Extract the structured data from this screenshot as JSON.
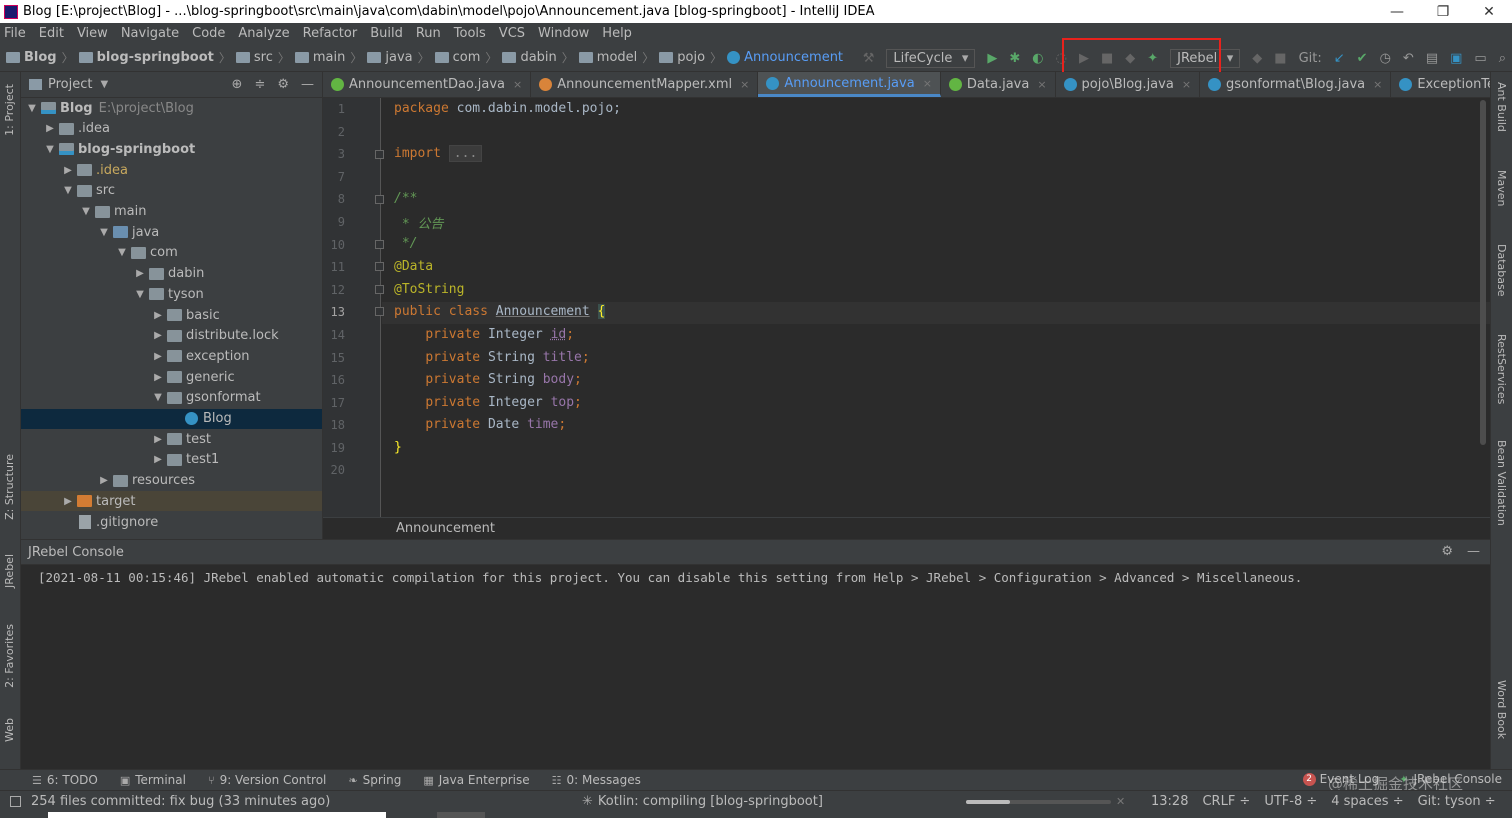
{
  "window": {
    "title": "Blog [E:\\project\\Blog] - ...\\blog-springboot\\src\\main\\java\\com\\dabin\\model\\pojo\\Announcement.java [blog-springboot] - IntelliJ IDEA",
    "controls": [
      "—",
      "❐",
      "✕"
    ]
  },
  "menu": [
    "File",
    "Edit",
    "View",
    "Navigate",
    "Code",
    "Analyze",
    "Refactor",
    "Build",
    "Run",
    "Tools",
    "VCS",
    "Window",
    "Help"
  ],
  "breadcrumbs": [
    "Blog",
    "blog-springboot",
    "src",
    "main",
    "java",
    "com",
    "dabin",
    "model",
    "pojo",
    "Announcement"
  ],
  "toolbar": {
    "lifecycle": "LifeCycle",
    "jrebel": "JRebel",
    "git": "Git:"
  },
  "left_strip": {
    "project": "1: Project",
    "structure": "Z: Structure",
    "jrebel": "JRebel",
    "favorites": "2: Favorites",
    "web": "Web"
  },
  "right_strip": [
    "Ant Build",
    "Maven",
    "Database",
    "RestServices",
    "Bean Validation",
    "Word Book"
  ],
  "project_panel": {
    "title": "Project",
    "tree": [
      {
        "label": "Blog",
        "hint": "E:\\project\\Blog",
        "depth": 0,
        "arrow": "▼",
        "icon": "mod",
        "bold": true
      },
      {
        "label": ".idea",
        "depth": 1,
        "arrow": "▶",
        "icon": "folder"
      },
      {
        "label": "blog-springboot",
        "depth": 1,
        "arrow": "▼",
        "icon": "mod",
        "bold": true
      },
      {
        "label": ".idea",
        "depth": 2,
        "arrow": "▶",
        "icon": "folder",
        "orange": true
      },
      {
        "label": "src",
        "depth": 2,
        "arrow": "▼",
        "icon": "folder"
      },
      {
        "label": "main",
        "depth": 3,
        "arrow": "▼",
        "icon": "folder"
      },
      {
        "label": "java",
        "depth": 4,
        "arrow": "▼",
        "icon": "blue"
      },
      {
        "label": "com",
        "depth": 5,
        "arrow": "▼",
        "icon": "folder"
      },
      {
        "label": "dabin",
        "depth": 6,
        "arrow": "▶",
        "icon": "folder"
      },
      {
        "label": "tyson",
        "depth": 6,
        "arrow": "▼",
        "icon": "folder"
      },
      {
        "label": "basic",
        "depth": 7,
        "arrow": "▶",
        "icon": "folder"
      },
      {
        "label": "distribute.lock",
        "depth": 7,
        "arrow": "▶",
        "icon": "folder"
      },
      {
        "label": "exception",
        "depth": 7,
        "arrow": "▶",
        "icon": "folder"
      },
      {
        "label": "generic",
        "depth": 7,
        "arrow": "▶",
        "icon": "folder"
      },
      {
        "label": "gsonformat",
        "depth": 7,
        "arrow": "▼",
        "icon": "folder"
      },
      {
        "label": "Blog",
        "depth": 8,
        "arrow": "",
        "icon": "class",
        "selected": true
      },
      {
        "label": "test",
        "depth": 7,
        "arrow": "▶",
        "icon": "folder"
      },
      {
        "label": "test1",
        "depth": 7,
        "arrow": "▶",
        "icon": "folder"
      },
      {
        "label": "resources",
        "depth": 4,
        "arrow": "▶",
        "icon": "folder"
      },
      {
        "label": "target",
        "depth": 2,
        "arrow": "▶",
        "icon": "orange",
        "excluded": true
      },
      {
        "label": ".gitignore",
        "depth": 2,
        "arrow": "",
        "icon": "file"
      }
    ]
  },
  "tabs": [
    {
      "label": "AnnouncementDao.java",
      "color": "#62b543"
    },
    {
      "label": "AnnouncementMapper.xml",
      "color": "#d9843a"
    },
    {
      "label": "Announcement.java",
      "color": "#3592c4",
      "active": true
    },
    {
      "label": "Data.java",
      "color": "#62b543"
    },
    {
      "label": "pojo\\Blog.java",
      "color": "#3592c4"
    },
    {
      "label": "gsonformat\\Blog.java",
      "color": "#3592c4"
    },
    {
      "label": "ExceptionTest.java",
      "color": "#3592c4"
    }
  ],
  "editor": {
    "line_numbers": [
      "1",
      "2",
      "3",
      "7",
      "8",
      "9",
      "10",
      "11",
      "12",
      "13",
      "14",
      "15",
      "16",
      "17",
      "18",
      "19",
      "20"
    ],
    "current_line": "13",
    "code": {
      "l1_kw": "package",
      "l1_rest": " com.dabin.model.pojo;",
      "l3_kw": "import",
      "l3_fold": "...",
      "l8": "/**",
      "l9": " * 公告",
      "l10": " */",
      "l11": "@Data",
      "l12": "@ToString",
      "l13_kw": "public class",
      "l13_name": "Announcement",
      "l13_brace": "{",
      "fields": [
        {
          "type": "Integer",
          "name": "id"
        },
        {
          "type": "String",
          "name": "title"
        },
        {
          "type": "String",
          "name": "body"
        },
        {
          "type": "Integer",
          "name": "top"
        },
        {
          "type": "Date",
          "name": "time"
        }
      ],
      "private_kw": "private",
      "l19": "}"
    },
    "footer_breadcrumb": "Announcement"
  },
  "console": {
    "title": "JRebel Console",
    "line": "[2021-08-11 00:15:46] JRebel enabled automatic compilation for this project. You can disable this setting from Help > JRebel > Configuration > Advanced > Miscellaneous."
  },
  "bottom_tools": [
    {
      "icon": "☰",
      "label": "6: TODO"
    },
    {
      "icon": "▣",
      "label": "Terminal"
    },
    {
      "icon": "⑂",
      "label": "9: Version Control"
    },
    {
      "icon": "❧",
      "label": "Spring"
    },
    {
      "icon": "▦",
      "label": "Java Enterprise"
    },
    {
      "icon": "☷",
      "label": "0: Messages"
    }
  ],
  "bottom_right": {
    "event_count": "2",
    "event_log": "Event Log",
    "jrebel_console": "JRebel Console"
  },
  "status": {
    "commit": "254 files committed: fix bug (33 minutes ago)",
    "task": "Kotlin: compiling [blog-springboot]",
    "progress_fraction": 0.3,
    "position": "13:28",
    "line_ending": "CRLF ÷",
    "encoding": "UTF-8 ÷",
    "indent": "4 spaces ÷",
    "branch": "Git: tyson ÷"
  },
  "watermark": "@稀土掘金技术社区"
}
